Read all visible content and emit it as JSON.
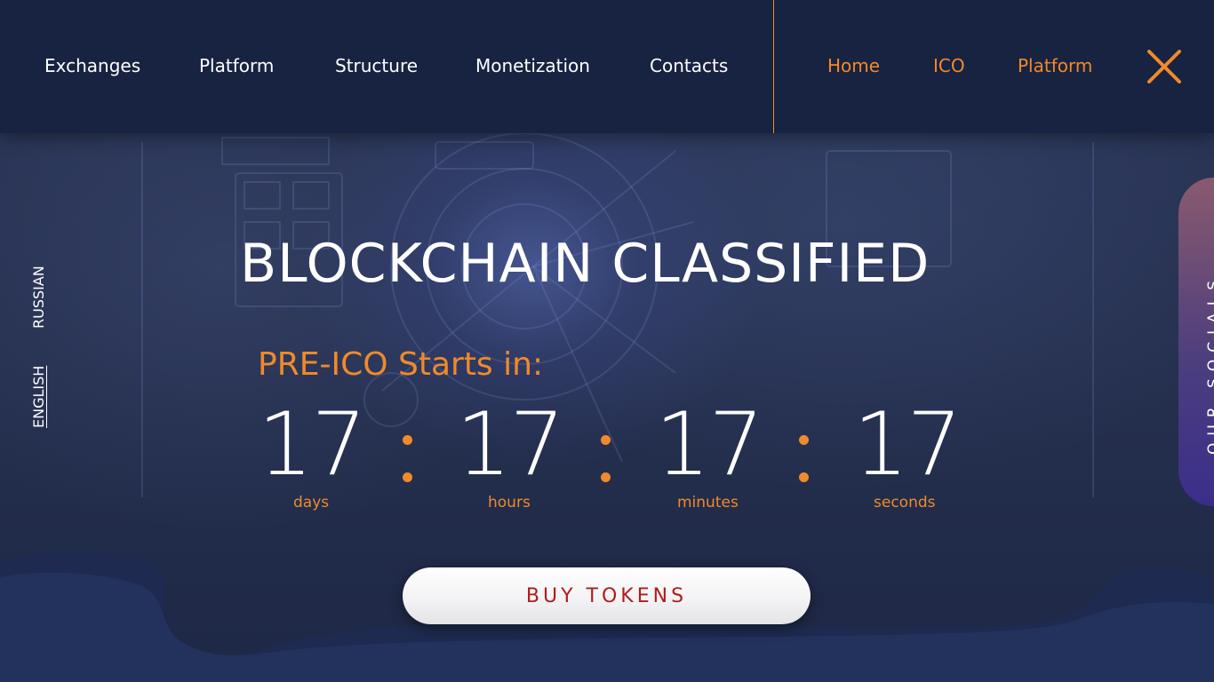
{
  "nav": {
    "main": [
      "Exchanges",
      "Platform",
      "Structure",
      "Monetization",
      "Contacts"
    ],
    "secondary": [
      "Home",
      "ICO",
      "Platform"
    ]
  },
  "languages": {
    "russian": "RUSSIAN",
    "english": "ENGLISH"
  },
  "hero": {
    "title": "BLOCKCHAIN CLASSIFIED",
    "preico_label": "PRE-ICO Starts in:",
    "countdown": [
      {
        "value": "17",
        "label": "days"
      },
      {
        "value": "17",
        "label": "hours"
      },
      {
        "value": "17",
        "label": "minutes"
      },
      {
        "value": "17",
        "label": "seconds"
      }
    ],
    "buy_button": "BUY TOKENS"
  },
  "socials": {
    "label": "OUR SOCIALS"
  },
  "icons": {
    "close": "close-icon"
  },
  "colors": {
    "accent": "#f08a2a",
    "header_bg": "#182241",
    "buy_text": "#b01c1c"
  }
}
